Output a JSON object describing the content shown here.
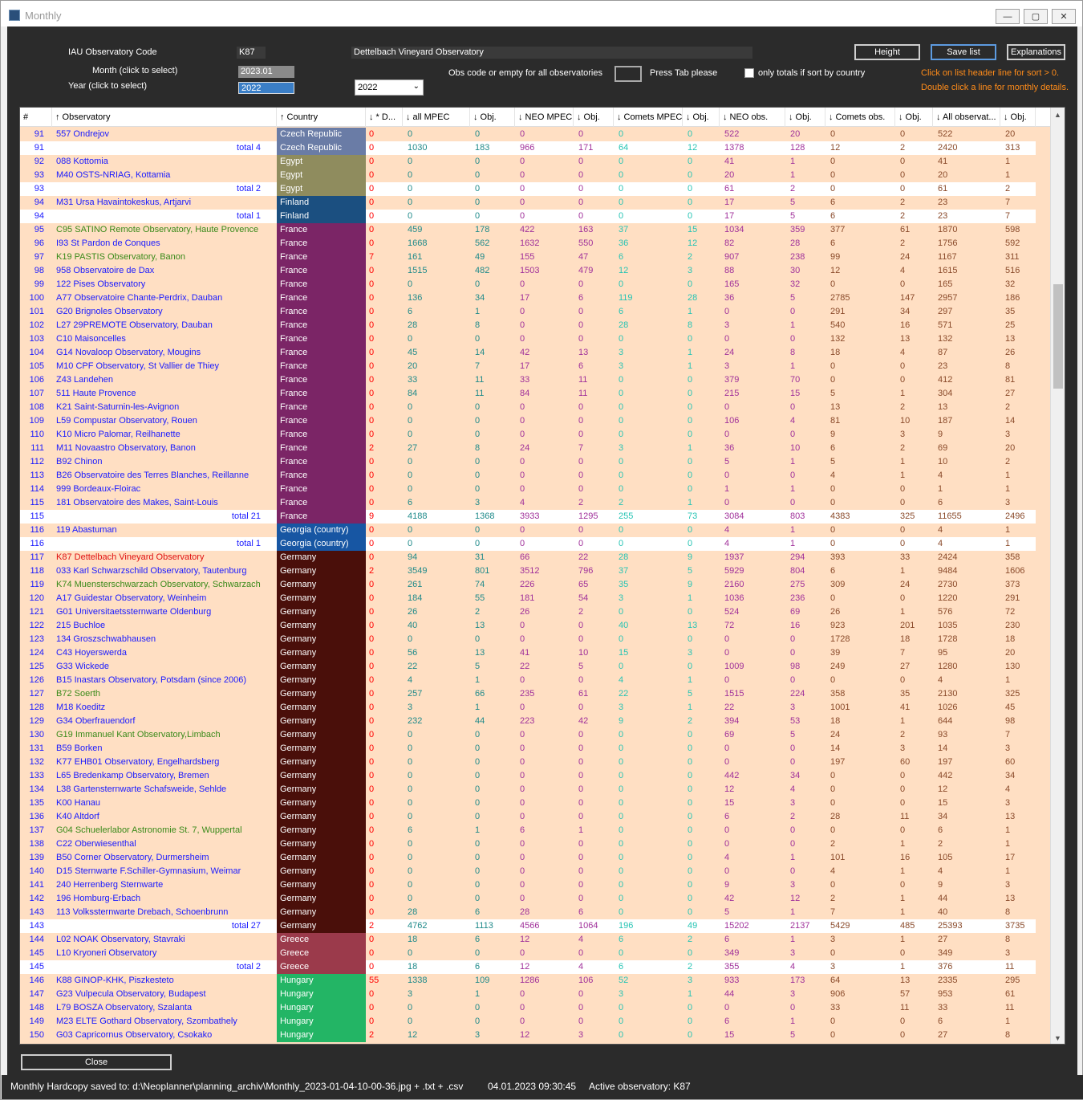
{
  "window": {
    "title": "Monthly",
    "min": "—",
    "max": "▢",
    "close": "✕"
  },
  "form": {
    "code_label": "IAU Observatory Code",
    "code_value": "K87",
    "obs_name": "Dettelbach Vineyard Observatory",
    "month_label": "Month (click to select)",
    "month_value": "2023.01",
    "year_label": "Year (click to select)",
    "year_value": "2022",
    "year_select": "2022",
    "obs_code_hint": "Obs code or empty for all observatories",
    "press_tab": "Press Tab please",
    "only_totals": "only totals if sort by country",
    "btn_height": "Height",
    "btn_save": "Save list",
    "btn_explanations": "Explanations",
    "hint1": "Click on list header line for sort > 0.",
    "hint2": "Double click a line for monthly details.",
    "close": "Close"
  },
  "columns": [
    "#",
    "↑ Observatory",
    "↑ Country",
    "↓ * D...",
    "↓ all MPEC",
    "↓ Obj.",
    "↓ NEO MPEC",
    "↓ Obj.",
    "↓ Comets MPEC",
    "↓ Obj.",
    "↓ NEO obs.",
    "↓ Obj.",
    "↓ Comets obs.",
    "↓ Obj.",
    "↓ All observat...",
    "↓ Obj."
  ],
  "country_colors": {
    "Czech Republic": "#6a7ca6",
    "Egypt": "#8f8c5e",
    "Finland": "#1b4f80",
    "France": "#7b2566",
    "Georgia (country)": "#1756a3",
    "Germany": "#4a0f0a",
    "Greece": "#9b3a4b",
    "Hungary": "#23b565"
  },
  "rows": [
    [
      "91",
      "557  Ondrejov",
      "Czech Republic",
      "0",
      "0",
      "0",
      "0",
      "0",
      "0",
      "0",
      "522",
      "20",
      "0",
      "0",
      "522",
      "20",
      "",
      ""
    ],
    [
      "91",
      "total 4",
      "Czech Republic",
      "0",
      "1030",
      "183",
      "966",
      "171",
      "64",
      "12",
      "1378",
      "128",
      "12",
      "2",
      "2420",
      "313",
      "t",
      ""
    ],
    [
      "92",
      "088  Kottomia",
      "Egypt",
      "0",
      "0",
      "0",
      "0",
      "0",
      "0",
      "0",
      "41",
      "1",
      "0",
      "0",
      "41",
      "1",
      "",
      ""
    ],
    [
      "93",
      "M40  OSTS-NRIAG, Kottamia",
      "Egypt",
      "0",
      "0",
      "0",
      "0",
      "0",
      "0",
      "0",
      "20",
      "1",
      "0",
      "0",
      "20",
      "1",
      "",
      ""
    ],
    [
      "93",
      "total 2",
      "Egypt",
      "0",
      "0",
      "0",
      "0",
      "0",
      "0",
      "0",
      "61",
      "2",
      "0",
      "0",
      "61",
      "2",
      "t",
      ""
    ],
    [
      "94",
      "M31  Ursa Havaintokeskus,  Artjarvi",
      "Finland",
      "0",
      "0",
      "0",
      "0",
      "0",
      "0",
      "0",
      "17",
      "5",
      "6",
      "2",
      "23",
      "7",
      "",
      ""
    ],
    [
      "94",
      "total 1",
      "Finland",
      "0",
      "0",
      "0",
      "0",
      "0",
      "0",
      "0",
      "17",
      "5",
      "6",
      "2",
      "23",
      "7",
      "t",
      ""
    ],
    [
      "95",
      "C95  SATINO Remote Observatory, Haute Provence",
      "France",
      "0",
      "459",
      "178",
      "422",
      "163",
      "37",
      "15",
      "1034",
      "359",
      "377",
      "61",
      "1870",
      "598",
      "",
      "g"
    ],
    [
      "96",
      "I93  St Pardon de Conques",
      "France",
      "0",
      "1668",
      "562",
      "1632",
      "550",
      "36",
      "12",
      "82",
      "28",
      "6",
      "2",
      "1756",
      "592",
      "",
      ""
    ],
    [
      "97",
      "K19  PASTIS Observatory, Banon",
      "France",
      "7",
      "161",
      "49",
      "155",
      "47",
      "6",
      "2",
      "907",
      "238",
      "99",
      "24",
      "1167",
      "311",
      "",
      "g"
    ],
    [
      "98",
      "958  Observatoire de Dax",
      "France",
      "0",
      "1515",
      "482",
      "1503",
      "479",
      "12",
      "3",
      "88",
      "30",
      "12",
      "4",
      "1615",
      "516",
      "",
      ""
    ],
    [
      "99",
      "122  Pises Observatory",
      "France",
      "0",
      "0",
      "0",
      "0",
      "0",
      "0",
      "0",
      "165",
      "32",
      "0",
      "0",
      "165",
      "32",
      "",
      ""
    ],
    [
      "100",
      "A77  Observatoire Chante-Perdrix, Dauban",
      "France",
      "0",
      "136",
      "34",
      "17",
      "6",
      "119",
      "28",
      "36",
      "5",
      "2785",
      "147",
      "2957",
      "186",
      "",
      ""
    ],
    [
      "101",
      "G20  Brignoles Observatory",
      "France",
      "0",
      "6",
      "1",
      "0",
      "0",
      "6",
      "1",
      "0",
      "0",
      "291",
      "34",
      "297",
      "35",
      "",
      ""
    ],
    [
      "102",
      "L27  29PREMOTE Observatory, Dauban",
      "France",
      "0",
      "28",
      "8",
      "0",
      "0",
      "28",
      "8",
      "3",
      "1",
      "540",
      "16",
      "571",
      "25",
      "",
      ""
    ],
    [
      "103",
      "C10  Maisoncelles",
      "France",
      "0",
      "0",
      "0",
      "0",
      "0",
      "0",
      "0",
      "0",
      "0",
      "132",
      "13",
      "132",
      "13",
      "",
      ""
    ],
    [
      "104",
      "G14  Novaloop Observatory, Mougins",
      "France",
      "0",
      "45",
      "14",
      "42",
      "13",
      "3",
      "1",
      "24",
      "8",
      "18",
      "4",
      "87",
      "26",
      "",
      ""
    ],
    [
      "105",
      "M10  CPF Observatory, St Vallier de Thiey",
      "France",
      "0",
      "20",
      "7",
      "17",
      "6",
      "3",
      "1",
      "3",
      "1",
      "0",
      "0",
      "23",
      "8",
      "",
      ""
    ],
    [
      "106",
      "Z43  Landehen",
      "France",
      "0",
      "33",
      "11",
      "33",
      "11",
      "0",
      "0",
      "379",
      "70",
      "0",
      "0",
      "412",
      "81",
      "",
      ""
    ],
    [
      "107",
      "511  Haute Provence",
      "France",
      "0",
      "84",
      "11",
      "84",
      "11",
      "0",
      "0",
      "215",
      "15",
      "5",
      "1",
      "304",
      "27",
      "",
      ""
    ],
    [
      "108",
      "K21  Saint-Saturnin-les-Avignon",
      "France",
      "0",
      "0",
      "0",
      "0",
      "0",
      "0",
      "0",
      "0",
      "0",
      "13",
      "2",
      "13",
      "2",
      "",
      ""
    ],
    [
      "109",
      "L59  Compustar Observatory, Rouen",
      "France",
      "0",
      "0",
      "0",
      "0",
      "0",
      "0",
      "0",
      "106",
      "4",
      "81",
      "10",
      "187",
      "14",
      "",
      ""
    ],
    [
      "110",
      "K10  Micro Palomar, Reilhanette",
      "France",
      "0",
      "0",
      "0",
      "0",
      "0",
      "0",
      "0",
      "0",
      "0",
      "9",
      "3",
      "9",
      "3",
      "",
      ""
    ],
    [
      "111",
      "M11  Novaastro Observatory, Banon",
      "France",
      "2",
      "27",
      "8",
      "24",
      "7",
      "3",
      "1",
      "36",
      "10",
      "6",
      "2",
      "69",
      "20",
      "",
      ""
    ],
    [
      "112",
      "B92  Chinon",
      "France",
      "0",
      "0",
      "0",
      "0",
      "0",
      "0",
      "0",
      "5",
      "1",
      "5",
      "1",
      "10",
      "2",
      "",
      ""
    ],
    [
      "113",
      "B26  Observatoire des Terres Blanches, Reillanne",
      "France",
      "0",
      "0",
      "0",
      "0",
      "0",
      "0",
      "0",
      "0",
      "0",
      "4",
      "1",
      "4",
      "1",
      "",
      ""
    ],
    [
      "114",
      "999  Bordeaux-Floirac",
      "France",
      "0",
      "0",
      "0",
      "0",
      "0",
      "0",
      "0",
      "1",
      "1",
      "0",
      "0",
      "1",
      "1",
      "",
      ""
    ],
    [
      "115",
      "181  Observatoire des Makes, Saint-Louis",
      "France",
      "0",
      "6",
      "3",
      "4",
      "2",
      "2",
      "1",
      "0",
      "0",
      "0",
      "0",
      "6",
      "3",
      "",
      ""
    ],
    [
      "115",
      "total 21",
      "France",
      "9",
      "4188",
      "1368",
      "3933",
      "1295",
      "255",
      "73",
      "3084",
      "803",
      "4383",
      "325",
      "11655",
      "2496",
      "t",
      ""
    ],
    [
      "116",
      "119  Abastuman",
      "Georgia (country)",
      "0",
      "0",
      "0",
      "0",
      "0",
      "0",
      "0",
      "4",
      "1",
      "0",
      "0",
      "4",
      "1",
      "",
      ""
    ],
    [
      "116",
      "total 1",
      "Georgia (country)",
      "0",
      "0",
      "0",
      "0",
      "0",
      "0",
      "0",
      "4",
      "1",
      "0",
      "0",
      "4",
      "1",
      "t",
      ""
    ],
    [
      "117",
      "K87  Dettelbach Vineyard Observatory",
      "Germany",
      "0",
      "94",
      "31",
      "66",
      "22",
      "28",
      "9",
      "1937",
      "294",
      "393",
      "33",
      "2424",
      "358",
      "",
      "r"
    ],
    [
      "118",
      "033  Karl Schwarzschild Observatory, Tautenburg",
      "Germany",
      "2",
      "3549",
      "801",
      "3512",
      "796",
      "37",
      "5",
      "5929",
      "804",
      "6",
      "1",
      "9484",
      "1606",
      "",
      ""
    ],
    [
      "119",
      "K74  Muensterschwarzach Observatory, Schwarzach",
      "Germany",
      "0",
      "261",
      "74",
      "226",
      "65",
      "35",
      "9",
      "2160",
      "275",
      "309",
      "24",
      "2730",
      "373",
      "",
      "g"
    ],
    [
      "120",
      "A17  Guidestar Observatory, Weinheim",
      "Germany",
      "0",
      "184",
      "55",
      "181",
      "54",
      "3",
      "1",
      "1036",
      "236",
      "0",
      "0",
      "1220",
      "291",
      "",
      ""
    ],
    [
      "121",
      "G01  Universitaetssternwarte Oldenburg",
      "Germany",
      "0",
      "26",
      "2",
      "26",
      "2",
      "0",
      "0",
      "524",
      "69",
      "26",
      "1",
      "576",
      "72",
      "",
      ""
    ],
    [
      "122",
      "215  Buchloe",
      "Germany",
      "0",
      "40",
      "13",
      "0",
      "0",
      "40",
      "13",
      "72",
      "16",
      "923",
      "201",
      "1035",
      "230",
      "",
      ""
    ],
    [
      "123",
      "134  Groszschwabhausen",
      "Germany",
      "0",
      "0",
      "0",
      "0",
      "0",
      "0",
      "0",
      "0",
      "0",
      "1728",
      "18",
      "1728",
      "18",
      "",
      ""
    ],
    [
      "124",
      "C43  Hoyerswerda",
      "Germany",
      "0",
      "56",
      "13",
      "41",
      "10",
      "15",
      "3",
      "0",
      "0",
      "39",
      "7",
      "95",
      "20",
      "",
      ""
    ],
    [
      "125",
      "G33  Wickede",
      "Germany",
      "0",
      "22",
      "5",
      "22",
      "5",
      "0",
      "0",
      "1009",
      "98",
      "249",
      "27",
      "1280",
      "130",
      "",
      ""
    ],
    [
      "126",
      "B15  Inastars Observatory, Potsdam (since 2006)",
      "Germany",
      "0",
      "4",
      "1",
      "0",
      "0",
      "4",
      "1",
      "0",
      "0",
      "0",
      "0",
      "4",
      "1",
      "",
      ""
    ],
    [
      "127",
      "B72  Soerth",
      "Germany",
      "0",
      "257",
      "66",
      "235",
      "61",
      "22",
      "5",
      "1515",
      "224",
      "358",
      "35",
      "2130",
      "325",
      "",
      "g"
    ],
    [
      "128",
      "M18  Koeditz",
      "Germany",
      "0",
      "3",
      "1",
      "0",
      "0",
      "3",
      "1",
      "22",
      "3",
      "1001",
      "41",
      "1026",
      "45",
      "",
      ""
    ],
    [
      "129",
      "G34  Oberfrauendorf",
      "Germany",
      "0",
      "232",
      "44",
      "223",
      "42",
      "9",
      "2",
      "394",
      "53",
      "18",
      "1",
      "644",
      "98",
      "",
      ""
    ],
    [
      "130",
      "G19  Immanuel Kant Observatory,Limbach",
      "Germany",
      "0",
      "0",
      "0",
      "0",
      "0",
      "0",
      "0",
      "69",
      "5",
      "24",
      "2",
      "93",
      "7",
      "",
      "g"
    ],
    [
      "131",
      "B59  Borken",
      "Germany",
      "0",
      "0",
      "0",
      "0",
      "0",
      "0",
      "0",
      "0",
      "0",
      "14",
      "3",
      "14",
      "3",
      "",
      ""
    ],
    [
      "132",
      "K77  EHB01 Observatory, Engelhardsberg",
      "Germany",
      "0",
      "0",
      "0",
      "0",
      "0",
      "0",
      "0",
      "0",
      "0",
      "197",
      "60",
      "197",
      "60",
      "",
      ""
    ],
    [
      "133",
      "L65  Bredenkamp Observatory, Bremen",
      "Germany",
      "0",
      "0",
      "0",
      "0",
      "0",
      "0",
      "0",
      "442",
      "34",
      "0",
      "0",
      "442",
      "34",
      "",
      ""
    ],
    [
      "134",
      "L38  Gartensternwarte Schafsweide, Sehlde",
      "Germany",
      "0",
      "0",
      "0",
      "0",
      "0",
      "0",
      "0",
      "12",
      "4",
      "0",
      "0",
      "12",
      "4",
      "",
      ""
    ],
    [
      "135",
      "K00  Hanau",
      "Germany",
      "0",
      "0",
      "0",
      "0",
      "0",
      "0",
      "0",
      "15",
      "3",
      "0",
      "0",
      "15",
      "3",
      "",
      ""
    ],
    [
      "136",
      "K40  Altdorf",
      "Germany",
      "0",
      "0",
      "0",
      "0",
      "0",
      "0",
      "0",
      "6",
      "2",
      "28",
      "11",
      "34",
      "13",
      "",
      ""
    ],
    [
      "137",
      "G04  Schuelerlabor Astronomie St. 7, Wuppertal",
      "Germany",
      "0",
      "6",
      "1",
      "6",
      "1",
      "0",
      "0",
      "0",
      "0",
      "0",
      "0",
      "6",
      "1",
      "",
      "g"
    ],
    [
      "138",
      "C22  Oberwiesenthal",
      "Germany",
      "0",
      "0",
      "0",
      "0",
      "0",
      "0",
      "0",
      "0",
      "0",
      "2",
      "1",
      "2",
      "1",
      "",
      ""
    ],
    [
      "139",
      "B50  Corner Observatory, Durmersheim",
      "Germany",
      "0",
      "0",
      "0",
      "0",
      "0",
      "0",
      "0",
      "4",
      "1",
      "101",
      "16",
      "105",
      "17",
      "",
      ""
    ],
    [
      "140",
      "D15  Sternwarte F.Schiller-Gymnasium, Weimar",
      "Germany",
      "0",
      "0",
      "0",
      "0",
      "0",
      "0",
      "0",
      "0",
      "0",
      "4",
      "1",
      "4",
      "1",
      "",
      ""
    ],
    [
      "141",
      "240  Herrenberg Sternwarte",
      "Germany",
      "0",
      "0",
      "0",
      "0",
      "0",
      "0",
      "0",
      "9",
      "3",
      "0",
      "0",
      "9",
      "3",
      "",
      ""
    ],
    [
      "142",
      "196  Homburg-Erbach",
      "Germany",
      "0",
      "0",
      "0",
      "0",
      "0",
      "0",
      "0",
      "42",
      "12",
      "2",
      "1",
      "44",
      "13",
      "",
      ""
    ],
    [
      "143",
      "113  Volkssternwarte Drebach, Schoenbrunn",
      "Germany",
      "0",
      "28",
      "6",
      "28",
      "6",
      "0",
      "0",
      "5",
      "1",
      "7",
      "1",
      "40",
      "8",
      "",
      ""
    ],
    [
      "143",
      "total 27",
      "Germany",
      "2",
      "4762",
      "1113",
      "4566",
      "1064",
      "196",
      "49",
      "15202",
      "2137",
      "5429",
      "485",
      "25393",
      "3735",
      "t",
      ""
    ],
    [
      "144",
      "L02  NOAK Observatory, Stavraki",
      "Greece",
      "0",
      "18",
      "6",
      "12",
      "4",
      "6",
      "2",
      "6",
      "1",
      "3",
      "1",
      "27",
      "8",
      "",
      ""
    ],
    [
      "145",
      "L10  Kryoneri Observatory",
      "Greece",
      "0",
      "0",
      "0",
      "0",
      "0",
      "0",
      "0",
      "349",
      "3",
      "0",
      "0",
      "349",
      "3",
      "",
      ""
    ],
    [
      "145",
      "total 2",
      "Greece",
      "0",
      "18",
      "6",
      "12",
      "4",
      "6",
      "2",
      "355",
      "4",
      "3",
      "1",
      "376",
      "11",
      "t",
      ""
    ],
    [
      "146",
      "K88  GINOP-KHK, Piszkesteto",
      "Hungary",
      "55",
      "1338",
      "109",
      "1286",
      "106",
      "52",
      "3",
      "933",
      "173",
      "64",
      "13",
      "2335",
      "295",
      "",
      ""
    ],
    [
      "147",
      "G23  Vulpecula Observatory, Budapest",
      "Hungary",
      "0",
      "3",
      "1",
      "0",
      "0",
      "3",
      "1",
      "44",
      "3",
      "906",
      "57",
      "953",
      "61",
      "",
      ""
    ],
    [
      "148",
      "L79  BOSZA Observatory, Szalanta",
      "Hungary",
      "0",
      "0",
      "0",
      "0",
      "0",
      "0",
      "0",
      "0",
      "0",
      "33",
      "11",
      "33",
      "11",
      "",
      ""
    ],
    [
      "149",
      "M23  ELTE Gothard Observatory, Szombathely",
      "Hungary",
      "0",
      "0",
      "0",
      "0",
      "0",
      "0",
      "0",
      "6",
      "1",
      "0",
      "0",
      "6",
      "1",
      "",
      ""
    ],
    [
      "150",
      "G03  Capricornus Observatory, Csokako",
      "Hungary",
      "2",
      "12",
      "3",
      "12",
      "3",
      "0",
      "0",
      "15",
      "5",
      "0",
      "0",
      "27",
      "8",
      "",
      ""
    ]
  ],
  "status": {
    "saved": "Monthly Hardcopy saved to: d:\\Neoplanner\\planning_archiv\\Monthly_2023-01-04-10-00-36.jpg + .txt + .csv",
    "datetime": "04.01.2023 09:30:45",
    "active": "Active observatory: K87"
  }
}
